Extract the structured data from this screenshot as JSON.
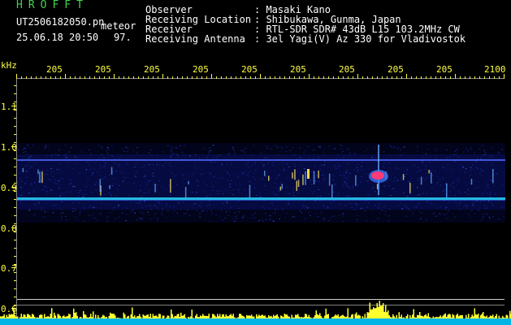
{
  "header": {
    "app_name": "HROFFT",
    "file_name": "UT2506182050.pn",
    "mode_label": "meteor",
    "date_time": "25.06.18 20:50",
    "counter": "97."
  },
  "station": {
    "labels": [
      "Observer",
      "Receiving Location",
      "Receiver",
      "Receiving Antenna"
    ],
    "values": [
      ": Masaki Kano",
      ": Shibukawa, Gunma, Japan",
      ": RTL-SDR SDR# 43dB L15 103.2MHz CW",
      ": 3el Yagi(V) Az 330 for Vladivostok"
    ]
  },
  "axes": {
    "y_unit": "kHz",
    "y_ticks": [
      "1.1",
      "1.0",
      "0.9",
      "0.8",
      "0.7",
      "0.6"
    ],
    "x_ticks": [
      "205",
      "205",
      "205",
      "205",
      "205",
      "205",
      "205",
      "205",
      "205",
      "2100"
    ]
  },
  "colors": {
    "background": "#000000",
    "title_green": "#3fd64a",
    "tick_yellow": "#ffff40",
    "text_white": "#ffffff",
    "noise_blue": "#1a2fae",
    "trace_cyan": "#2ad8ff",
    "echo_magenta": "#ff3a78"
  }
}
